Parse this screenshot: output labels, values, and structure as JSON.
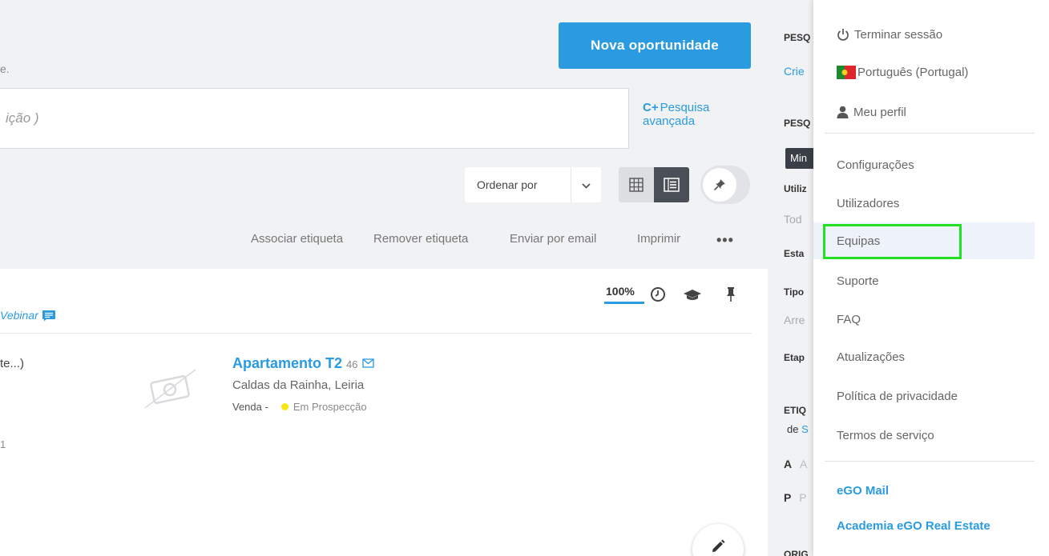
{
  "header": {
    "subtitle_fragment": "e.",
    "new_opportunity_button": "Nova oportunidade"
  },
  "search": {
    "placeholder_fragment": "ição )",
    "advanced_icon": "C+",
    "advanced_label_line1": "Pesquisa",
    "advanced_label_line2": "avançada"
  },
  "toolbar": {
    "order_by_label": "Ordenar por",
    "order_chevron": "⌄",
    "grid_view_icon": "grid-icon",
    "list_view_icon": "list-icon",
    "pin_icon": "pin-icon"
  },
  "actions": [
    {
      "label": "Associar etiqueta"
    },
    {
      "label": "Remover etiqueta"
    },
    {
      "label": "Enviar por email"
    },
    {
      "label": "Imprimir"
    }
  ],
  "more_label": "•••",
  "list": {
    "webinar_label": "Vebinar",
    "percent_label": "100%",
    "row_left_text": "te...)",
    "row_left_num": "1",
    "property": {
      "title": "Apartamento T2",
      "ref": "46",
      "location": "Caldas da Rainha, Leiria",
      "deal_type": "Venda -",
      "status": "Em Prospecção",
      "status_color": "#f7e514"
    }
  },
  "right_panel": {
    "pesq1_label": "PESQ",
    "crie_link": "Crie",
    "pesq2_label": "PESQ",
    "chip": "Min",
    "utiliz_label": "Utiliz",
    "todo_value": "Tod",
    "esta_label": "Esta",
    "tipo_label": "Tipo",
    "arre_value": "Arre",
    "etap_label": "Etap",
    "etiq_label": "ETIQ",
    "de_text": "de",
    "de_link": "S",
    "a_bold": "A",
    "a_gray": "A",
    "p_bold": "P",
    "p_gray": "P",
    "orig_label": "ORIG"
  },
  "menu": {
    "logout": "Terminar sessão",
    "language": "Português (Portugal)",
    "profile": "Meu perfil",
    "settings": "Configurações",
    "users": "Utilizadores",
    "teams": "Equipas",
    "support": "Suporte",
    "faq": "FAQ",
    "updates": "Atualizações",
    "privacy": "Política de privacidade",
    "terms": "Termos de serviço",
    "ego_mail": "eGO Mail",
    "academy": "Academia eGO Real Estate"
  },
  "colors": {
    "accent": "#2a9be0",
    "highlight_border": "#22e022",
    "dark_button": "#4a4f57"
  }
}
